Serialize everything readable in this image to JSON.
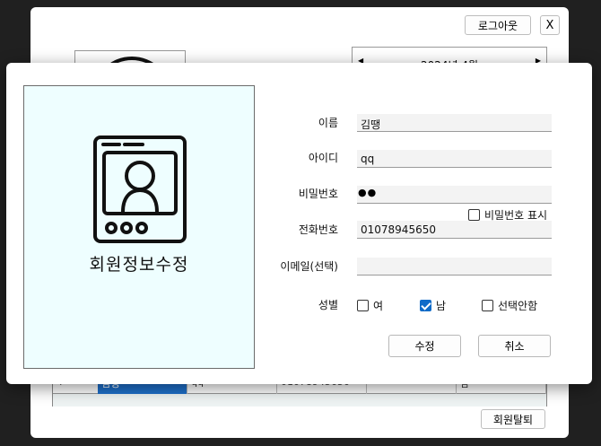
{
  "background_window": {
    "logout_label": "로그아웃",
    "close_label": "X",
    "calendar_title": "2024년 4월",
    "calendar_prev": "◀",
    "calendar_next": "▶",
    "grid": {
      "row_arrow": "▶",
      "cells": [
        "김땡",
        "qq",
        "01078945650",
        "",
        "남"
      ]
    },
    "withdraw_label": "회원탈퇴"
  },
  "dialog": {
    "side_title": "회원정보수정",
    "labels": {
      "name": "이름",
      "id": "아이디",
      "password": "비밀번호",
      "phone": "전화번호",
      "email": "이메일(선택)",
      "gender": "성별"
    },
    "values": {
      "name": "김땡",
      "id": "qq",
      "password_mask": "●●",
      "phone": "01078945650",
      "email": ""
    },
    "show_password": {
      "label": "비밀번호 표시",
      "checked": false
    },
    "gender_options": [
      {
        "label": "여",
        "checked": false
      },
      {
        "label": "남",
        "checked": true
      },
      {
        "label": "선택안함",
        "checked": false
      }
    ],
    "buttons": {
      "save": "수정",
      "cancel": "취소"
    },
    "icon": "profile-card-icon",
    "accent_color": "#0f6bc8",
    "panel_color": "#eefeff"
  }
}
